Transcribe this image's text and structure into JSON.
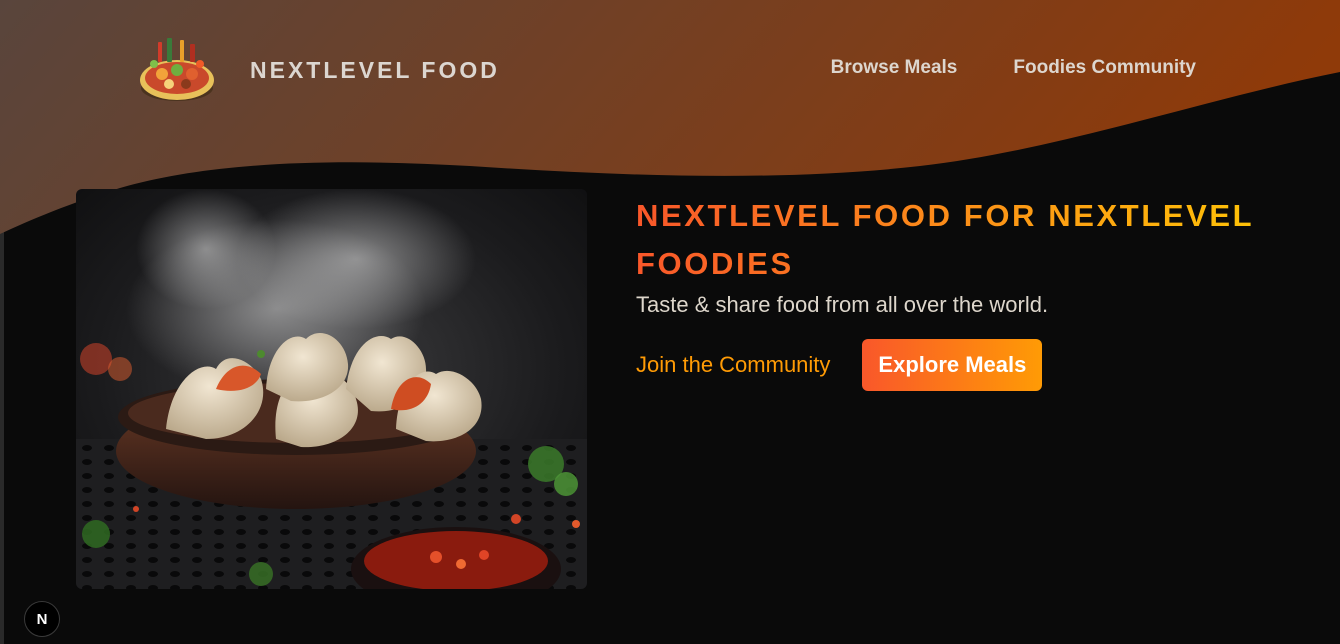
{
  "header": {
    "logo_text": "NEXTLEVEL FOOD",
    "nav": [
      {
        "label": "Browse Meals"
      },
      {
        "label": "Foodies Community"
      }
    ]
  },
  "hero": {
    "title": "NEXTLEVEL FOOD FOR NEXTLEVEL FOODIES",
    "subtitle": "Taste & share food from all over the world.",
    "cta_link": "Join the Community",
    "cta_button": "Explore Meals"
  },
  "dev_badge": {
    "label": "N"
  },
  "colors": {
    "background": "#0a0a0a",
    "header_gradient_start": "#59453c",
    "header_gradient_end": "#8f3a09",
    "title_gradient_start": "#f9572a",
    "title_gradient_end": "#ffc905",
    "accent": "#ff9b05"
  }
}
